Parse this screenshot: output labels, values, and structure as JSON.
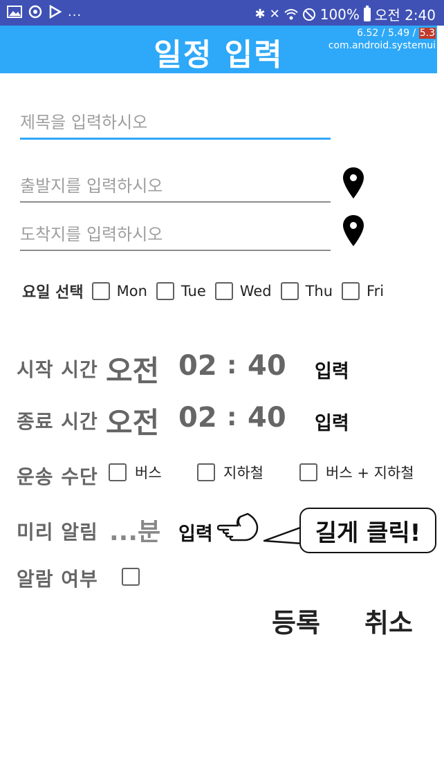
{
  "status_bar": {
    "left_icons": [
      "image-icon",
      "sync-icon",
      "play-store-icon"
    ],
    "overflow": "...",
    "battery": "100%",
    "time": "오전 2:40"
  },
  "app_bar": {
    "title": "일정 입력",
    "overlay_values": [
      "6.52",
      "5.49",
      "5.3"
    ],
    "overlay_source": "com.android.systemui",
    "color": "#2ea8f8"
  },
  "form": {
    "title_placeholder": "제목을 입력하시오",
    "origin_placeholder": "출발지를 입력하시오",
    "destination_placeholder": "도착지를 입력하시오",
    "day_label": "요일 선택",
    "days": [
      "Mon",
      "Tue",
      "Wed",
      "Thu",
      "Fri"
    ],
    "start_time": {
      "label": "시작 시간",
      "ampm": "오전",
      "hour": "02",
      "sep": ":",
      "minute": "40",
      "button": "입력"
    },
    "end_time": {
      "label": "종료 시간",
      "ampm": "오전",
      "hour": "02",
      "sep": ":",
      "minute": "40",
      "button": "입력"
    },
    "transport": {
      "label": "운송 수단",
      "options": [
        "버스",
        "지하철",
        "버스 + 지하철"
      ]
    },
    "reminder": {
      "label": "미리 알림",
      "value": "...분",
      "button": "입력",
      "tip": "길게 클릭!"
    },
    "alarm": {
      "label": "알람 여부"
    },
    "submit": "등록",
    "cancel": "취소"
  }
}
